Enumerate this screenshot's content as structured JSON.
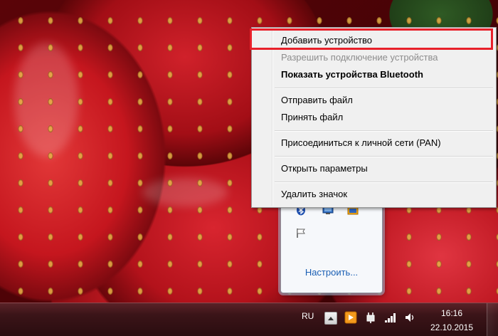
{
  "context_menu": {
    "items": [
      {
        "label": "Добавить устройство",
        "state": "highlighted"
      },
      {
        "label": "Разрешить подключение устройства",
        "state": "disabled"
      },
      {
        "label": "Показать устройства Bluetooth",
        "state": "default-bold"
      },
      {
        "label": "Отправить файл",
        "state": "normal"
      },
      {
        "label": "Принять файл",
        "state": "normal"
      },
      {
        "label": "Присоединиться к личной сети (PAN)",
        "state": "normal"
      },
      {
        "label": "Открыть параметры",
        "state": "normal"
      },
      {
        "label": "Удалить значок",
        "state": "normal"
      }
    ],
    "highlight_color": "#e8202a"
  },
  "tray_popup": {
    "icons": [
      "bluetooth-icon",
      "network-monitor-icon",
      "volume-tray-icon",
      "action-center-flag-icon"
    ],
    "customize_label": "Настроить..."
  },
  "taskbar": {
    "language": "RU",
    "tray_icons": [
      "show-hidden-icons-arrow-icon",
      "media-player-icon",
      "power-plug-icon",
      "signal-bars-icon",
      "speaker-icon"
    ],
    "time": "16:16",
    "date": "22.10.2015"
  },
  "colors": {
    "menu_background": "#f0f0f0",
    "link_blue": "#1a5fb4",
    "taskbar": "#3b1418"
  }
}
